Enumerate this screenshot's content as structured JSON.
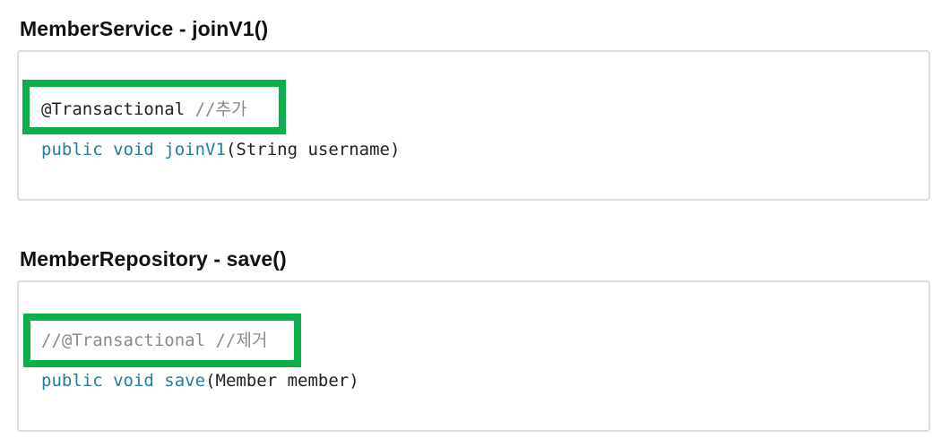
{
  "sections": [
    {
      "title": "MemberService - joinV1()",
      "annotation": {
        "text": "@Transactional",
        "comment": "//추가"
      },
      "signature": {
        "modifiers": "public void",
        "method": "joinV1",
        "params": "(String username)"
      }
    },
    {
      "title": "MemberRepository - save()",
      "annotation": {
        "text": "",
        "comment": "//@Transactional //제거"
      },
      "signature": {
        "modifiers": "public void",
        "method": "save",
        "params": "(Member member)"
      }
    }
  ],
  "colors": {
    "highlight_border": "#0bb04b",
    "keyword": "#1f7ea1",
    "comment": "#8a8a8a",
    "box_border": "#dcdcdc"
  }
}
